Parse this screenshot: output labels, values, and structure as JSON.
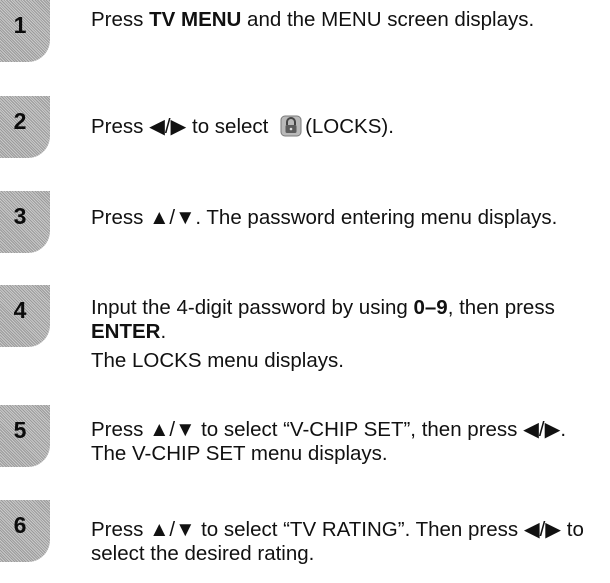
{
  "steps": [
    {
      "number": "1",
      "lines": [
        {
          "segments": [
            {
              "text": "Press "
            },
            {
              "text": "TV MENU",
              "bold": true
            },
            {
              "text": " and the MENU screen displays."
            }
          ]
        }
      ]
    },
    {
      "number": "2",
      "lines": [
        {
          "segments": [
            {
              "text": "Press ◀/▶ to select "
            },
            {
              "icon": "locks-icon"
            },
            {
              "text": "(LOCKS)."
            }
          ]
        }
      ]
    },
    {
      "number": "3",
      "lines": [
        {
          "segments": [
            {
              "text": "Press ▲/▼. The password entering menu displays."
            }
          ]
        }
      ]
    },
    {
      "number": "4",
      "lines": [
        {
          "segments": [
            {
              "text": "Input the 4-digit password by using "
            },
            {
              "text": "0–9",
              "bold": true
            },
            {
              "text": ", then press "
            },
            {
              "text": "ENTER",
              "bold": true
            },
            {
              "text": "."
            }
          ]
        },
        {
          "segments": [
            {
              "text": "The LOCKS menu displays."
            }
          ]
        }
      ]
    },
    {
      "number": "5",
      "lines": [
        {
          "segments": [
            {
              "text": "Press ▲/▼ to select “V-CHIP SET”, then press ◀/▶. The V-CHIP SET menu displays."
            }
          ]
        }
      ]
    },
    {
      "number": "6",
      "lines": [
        {
          "segments": [
            {
              "text": "Press ▲/▼ to select “TV RATING”. Then press ◀/▶ to select the desired rating."
            }
          ]
        }
      ]
    }
  ]
}
